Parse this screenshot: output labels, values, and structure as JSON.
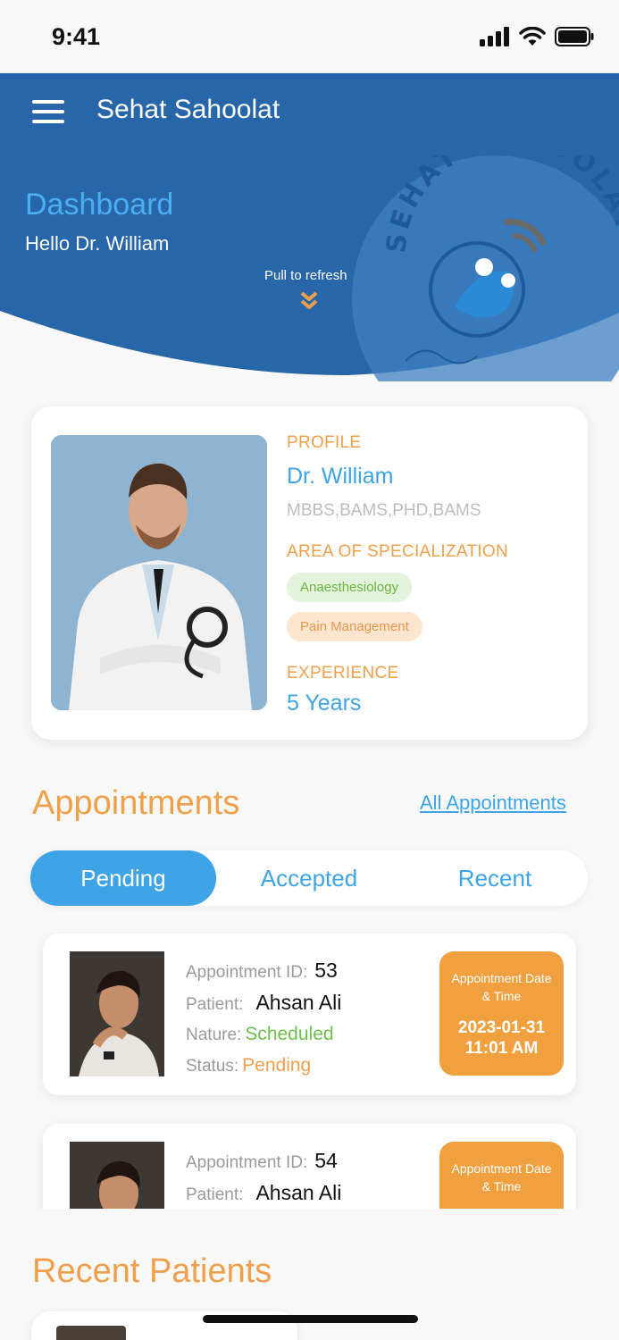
{
  "status_bar": {
    "time": "9:41"
  },
  "header": {
    "app_title": "Sehat Sahoolat",
    "dashboard_title": "Dashboard",
    "greeting": "Hello Dr. William",
    "pull_to_refresh": "Pull to refresh",
    "logo_text": "SEHAT SAHOOLAT",
    "colors": {
      "header_bg": "#2766a8",
      "accent_blue": "#3ea4e6",
      "accent_orange": "#f0a04b"
    }
  },
  "profile": {
    "section_label": "PROFILE",
    "name": "Dr. William",
    "qualifications": "MBBS,BAMS,PHD,BAMS",
    "specialization_label": "AREA OF SPECIALIZATION",
    "specializations": [
      "Anaesthesiology",
      "Pain Management"
    ],
    "experience_label": "EXPERIENCE",
    "experience_value": "5 Years"
  },
  "appointments": {
    "title": "Appointments",
    "all_link": "All Appointments",
    "tabs": [
      "Pending",
      "Accepted",
      "Recent"
    ],
    "active_tab": "Pending",
    "field_labels": {
      "id": "Appointment ID:",
      "patient": "Patient:",
      "nature": "Nature:",
      "status": "Status:"
    },
    "date_label": "Appointment Date & Time",
    "items": [
      {
        "id": "53",
        "patient": "Ahsan Ali",
        "nature": "Scheduled",
        "status": "Pending",
        "date": "2023-01-31",
        "time": "11:01 AM"
      },
      {
        "id": "54",
        "patient": "Ahsan Ali"
      }
    ]
  },
  "recent_patients": {
    "title": "Recent Patients"
  }
}
